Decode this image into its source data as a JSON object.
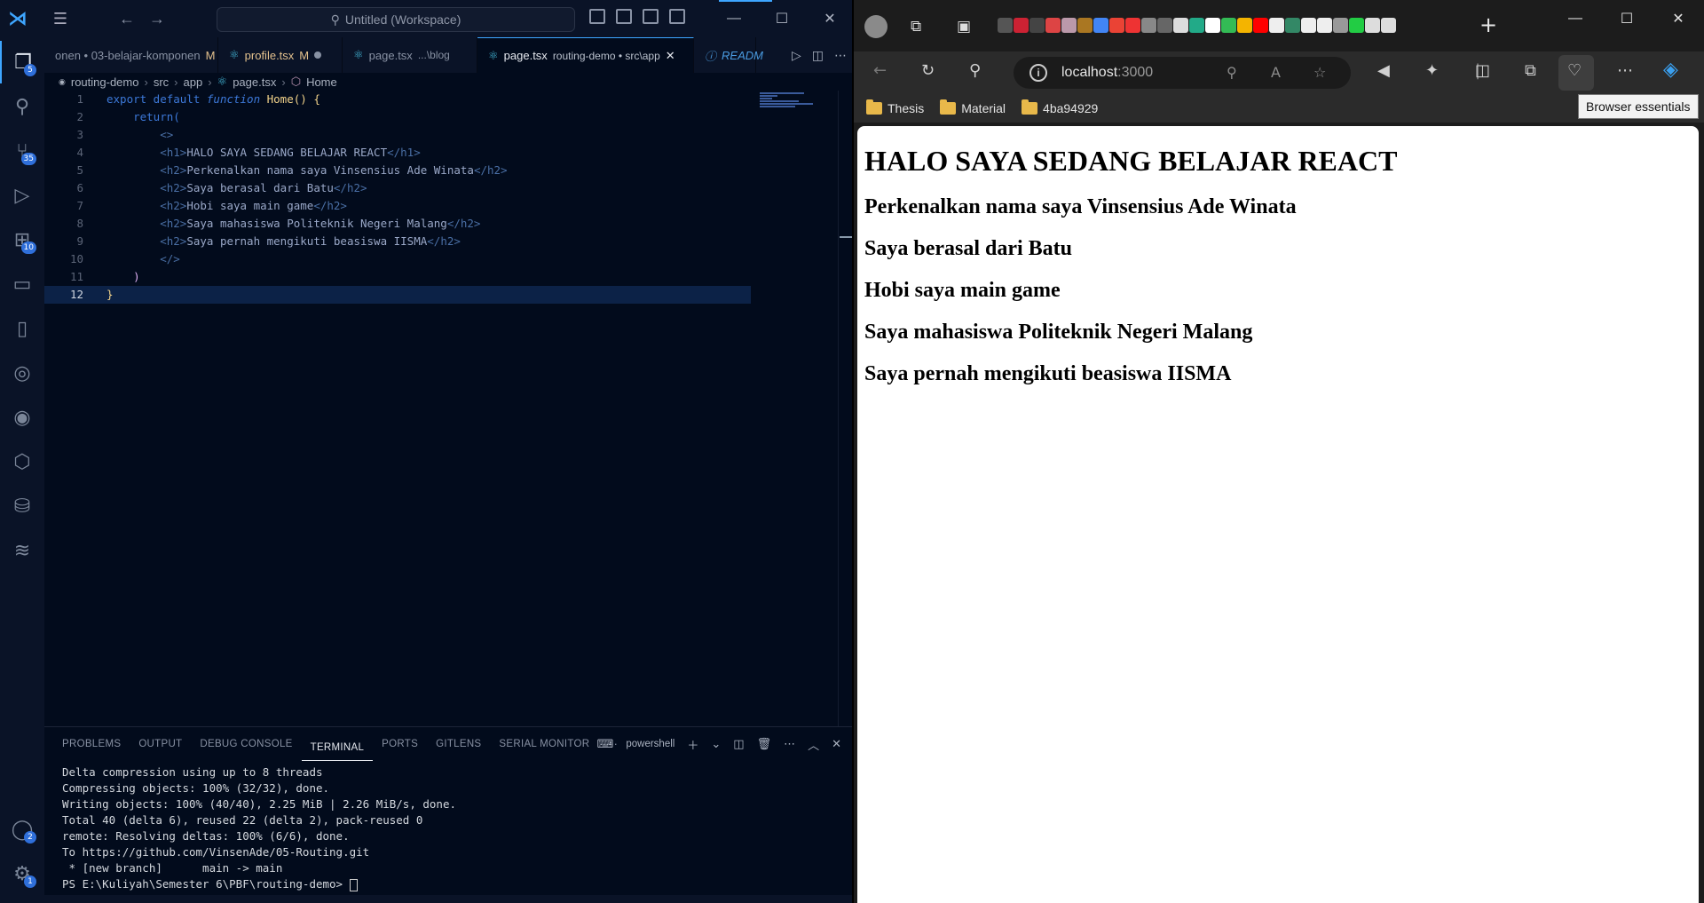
{
  "vscode": {
    "title": "Untitled (Workspace)",
    "activity_badges": {
      "explorer": "5",
      "source_control": "35",
      "extensions": "10",
      "accounts": "2",
      "settings": "1"
    },
    "tabs": [
      {
        "label": "onen • 03-belajar-komponen",
        "status": "M"
      },
      {
        "label": "profile.tsx",
        "status": "M"
      },
      {
        "label": "page.tsx",
        "desc": "...\\blog"
      },
      {
        "label": "page.tsx",
        "desc": "routing-demo • src\\app"
      },
      {
        "label": "READM"
      }
    ],
    "breadcrumb": [
      "routing-demo",
      "src",
      "app",
      "page.tsx",
      "Home"
    ],
    "code": {
      "l1_export": "export default ",
      "l1_function": "function",
      "l1_name": " Home",
      "l1_rest": "() {",
      "l2": "return(",
      "l3": "<>",
      "l4_text": "HALO SAYA SEDANG BELAJAR REACT",
      "l5_text": "Perkenalkan nama saya Vinsensius Ade Winata",
      "l6_text": "Saya berasal dari Batu",
      "l7_text": "Hobi saya main game",
      "l8_text": "Saya mahasiswa Politeknik Negeri Malang",
      "l9_text": "Saya pernah mengikuti beasiswa IISMA",
      "l10": "</>",
      "l11": ")",
      "l12": "}",
      "h1_open": "<h1>",
      "h1_close": "</h1>",
      "h2_open": "<h2>",
      "h2_close": "</h2>"
    },
    "panel_tabs": [
      "PROBLEMS",
      "OUTPUT",
      "DEBUG CONSOLE",
      "TERMINAL",
      "PORTS",
      "GITLENS",
      "SERIAL MONITOR"
    ],
    "terminal_shell": "powershell",
    "terminal_lines": [
      "Delta compression using up to 8 threads",
      "Compressing objects: 100% (32/32), done.",
      "Writing objects: 100% (40/40), 2.25 MiB | 2.26 MiB/s, done.",
      "Total 40 (delta 6), reused 22 (delta 2), pack-reused 0",
      "remote: Resolving deltas: 100% (6/6), done.",
      "To https://github.com/VinsenAde/05-Routing.git",
      " * [new branch]      main -> main",
      "PS E:\\Kuliyah\\Semester 6\\PBF\\routing-demo> "
    ]
  },
  "browser": {
    "url_host": "localhost",
    "url_port": ":3000",
    "bookmarks": [
      "Thesis",
      "Material",
      "4ba94929"
    ],
    "tooltip": "Browser essentials",
    "page": {
      "h1": "HALO SAYA SEDANG BELAJAR REACT",
      "h2": [
        "Perkenalkan nama saya Vinsensius Ade Winata",
        "Saya berasal dari Batu",
        "Hobi saya main game",
        "Saya mahasiswa Politeknik Negeri Malang",
        "Saya pernah mengikuti beasiswa IISMA"
      ]
    }
  }
}
